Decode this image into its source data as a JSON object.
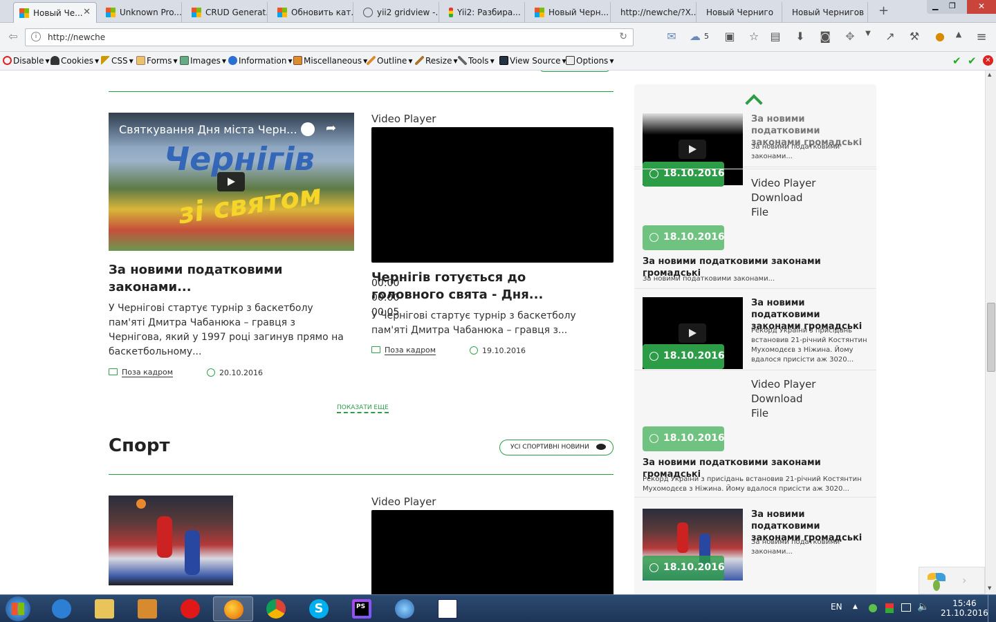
{
  "browser": {
    "tabs": [
      {
        "label": "Новый Че...",
        "active": true,
        "icon": "windows-favicon"
      },
      {
        "label": "Unknown Pro...",
        "icon": "windows-favicon"
      },
      {
        "label": "CRUD Generat...",
        "icon": "windows-favicon"
      },
      {
        "label": "Обновить кат...",
        "icon": "windows-favicon"
      },
      {
        "label": "yii2 gridview -...",
        "icon": "google-favicon"
      },
      {
        "label": "Yii2: Разбира...",
        "icon": "traffic-light-favicon"
      },
      {
        "label": "Новый Черн...",
        "icon": "windows-favicon"
      },
      {
        "label": "http://newche/?X..."
      },
      {
        "label": "Новый Черниго"
      },
      {
        "label": "Новый Чернигов"
      }
    ],
    "new_tab": "+",
    "address": "http://newche",
    "cloud_count": "5"
  },
  "devtoolbar": {
    "items": [
      "Disable",
      "Cookies",
      "CSS",
      "Forms",
      "Images",
      "Information",
      "Miscellaneous",
      "Outline",
      "Resize",
      "Tools",
      "View Source",
      "Options"
    ]
  },
  "main": {
    "cards": [
      {
        "video_title": "Святкування Дня міста Черн...",
        "title": "За новими податковими законами...",
        "text": "У Чернігові стартує турнір з баскетболу пам'яті Дмитра Чабанюка – гравця з Чернігова, який у 1997 році загинув прямо на баскетбольному...",
        "category": "Поза кадром",
        "date": "20.10.2016"
      },
      {
        "player_label": "Video Player",
        "time_lines": [
          "00:00",
          "00:00",
          "00:05"
        ],
        "title": "Чернігів готується до головного свята - Дня...",
        "text": "У Чернігові стартує турнір з баскетболу пам'яті Дмитра Чабанюка – гравця з...",
        "category": "Поза кадром",
        "date": "19.10.2016"
      }
    ],
    "show_more": "ПОКАЗАТИ ЕЩЕ",
    "sport": {
      "heading": "Спорт",
      "all_button": "УСІ СПОРТИВНІ НОВИНИ",
      "player_label": "Video Player"
    }
  },
  "sidebar": {
    "items": [
      {
        "title": "За новими податковими законами громадські",
        "text": "За новими податковими законами...",
        "date": "18.10.2016"
      },
      {
        "player_lines": [
          "Video Player",
          "Download",
          "File"
        ],
        "date": "18.10.2016",
        "title": "За новими податковими законами громадські",
        "text": "За новими податковими законами..."
      },
      {
        "title": "За новими податковими законами громадські",
        "text": "Рекорд України з присідань встановив 21-річний Костянтин Мухомодєєв з Ніжина. Йому вдалося присісти аж 3020...",
        "date": "18.10.2016"
      },
      {
        "player_lines": [
          "Video Player",
          "Download",
          "File"
        ],
        "date": "18.10.2016",
        "title": "За новими податковими законами громадські",
        "text": "Рекорд України з присідань встановив 21-річний Костянтин Мухомодєєв з Ніжина. Йому вдалося присісти аж 3020..."
      },
      {
        "title": "За новими податковими законами громадські",
        "text": "За новими податковими законами...",
        "date": "18.10.2016"
      }
    ]
  },
  "taskbar": {
    "lang": "EN",
    "time": "15:46",
    "date": "21.10.2016"
  },
  "colors": {
    "accent": "#239c3e",
    "badge": "#2d9c47",
    "badge_light": "#70c281"
  }
}
